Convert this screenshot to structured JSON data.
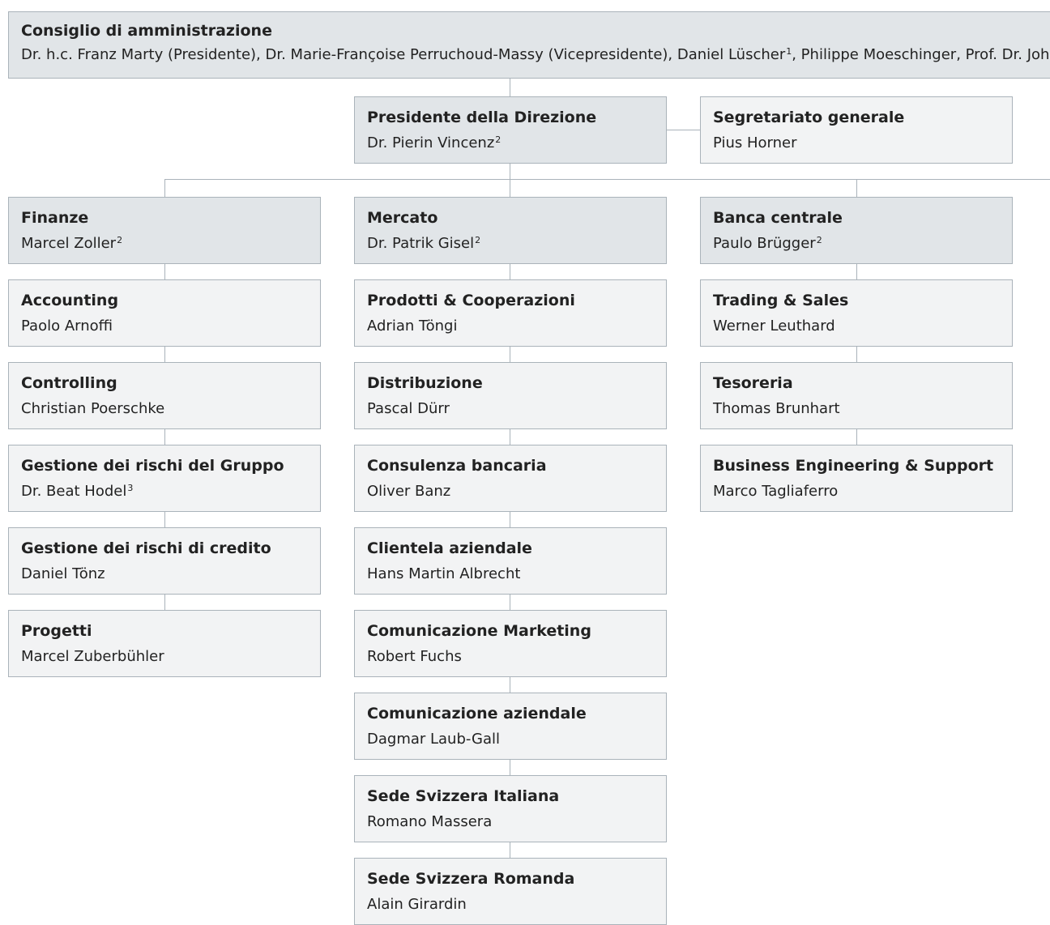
{
  "board": {
    "title": "Consiglio di amministrazione",
    "members": "Dr. h.c. Franz Marty (Presidente), Dr. Marie-Françoise Perruchoud-Massy (Vicepresidente), Daniel Lüscher",
    "members_sup": "1",
    "members_rest": ", Philippe Moeschinger, Prof. Dr. Johannes"
  },
  "president": {
    "title": "Presidente della Direzione",
    "name": "Dr. Pierin Vincenz",
    "sup": "2"
  },
  "secretariat": {
    "title": "Segretariato generale",
    "name": "Pius Horner"
  },
  "finance": {
    "title": "Finanze",
    "name": "Marcel Zoller",
    "sup": "2",
    "units": [
      {
        "title": "Accounting",
        "name": "Paolo Arnoffi"
      },
      {
        "title": "Controlling",
        "name": "Christian Poerschke"
      },
      {
        "title": "Gestione dei rischi del Gruppo",
        "name": "Dr. Beat Hodel",
        "sup": "3"
      },
      {
        "title": "Gestione dei rischi di credito",
        "name": "Daniel Tönz"
      },
      {
        "title": "Progetti",
        "name": "Marcel Zuberbühler"
      }
    ]
  },
  "market": {
    "title": "Mercato",
    "name": "Dr. Patrik Gisel",
    "sup": "2",
    "units": [
      {
        "title": "Prodotti & Cooperazioni",
        "name": "Adrian Töngi"
      },
      {
        "title": "Distribuzione",
        "name": "Pascal Dürr"
      },
      {
        "title": "Consulenza bancaria",
        "name": "Oliver Banz"
      },
      {
        "title": "Clientela aziendale",
        "name": "Hans Martin Albrecht"
      },
      {
        "title": "Comunicazione Marketing",
        "name": "Robert Fuchs"
      },
      {
        "title": "Comunicazione aziendale",
        "name": "Dagmar Laub-Gall"
      },
      {
        "title": "Sede Svizzera Italiana",
        "name": "Romano Massera"
      },
      {
        "title": "Sede Svizzera Romanda",
        "name": "Alain Girardin"
      }
    ]
  },
  "central": {
    "title": "Banca centrale",
    "name": "Paulo Brügger",
    "sup": "2",
    "units": [
      {
        "title": "Trading & Sales",
        "name": "Werner Leuthard"
      },
      {
        "title": "Tesoreria",
        "name": "Thomas Brunhart"
      },
      {
        "title": "Business Engineering & Support",
        "name": "Marco Tagliaferro"
      }
    ]
  },
  "colors": {
    "border": "#aab3ba",
    "head_fill": "#e1e5e8",
    "unit_fill": "#f2f3f4"
  }
}
